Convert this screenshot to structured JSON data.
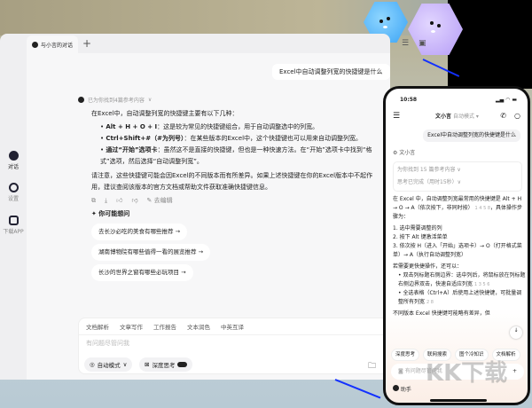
{
  "tab": {
    "title": "与小言的对话",
    "new_tab": "+"
  },
  "sidebar": [
    {
      "label": "对话"
    },
    {
      "label": "设置"
    },
    {
      "label": "下载APP"
    }
  ],
  "desktop": {
    "user_question": "Excel中自动调整列宽的快捷键是什么",
    "refs": "已为你找到4篇参考内容",
    "intro": "在Excel中，自动调整列宽的快捷键主要有以下几种：",
    "bullets": [
      {
        "bold": "Alt + H + O + I",
        "text": "：这是较为常见的快捷键组合，用于自动调整选中的列宽。"
      },
      {
        "bold": "Ctrl+Shift+#（#为列号）",
        "text": "：在某些版本的Excel中，这个快捷键也可以用来自动调整列宽。"
      },
      {
        "bold": "通过“开始”选项卡",
        "text": "：虽然这不是直接的快捷键，但也是一种快速方法。在“开始”选项卡中找到“格式”选项，然后选择“自动调整列宽”。"
      }
    ],
    "note": "请注意，这些快捷键可能会因Excel的不同版本而有所差异。如果上述快捷键在你的Excel版本中不起作用，建议查阅该版本的官方文档或帮助文件获取准确快捷键信息。",
    "edit": "去编辑",
    "suggest_title": "✦ 你可能想问",
    "suggestions": [
      "去长沙必吃的美食有哪些推荐 →",
      "湖南博物院有哪些值得一看的展览推荐 →",
      "长沙的世界之窗有哪些必玩项目 →"
    ],
    "quick_tools": [
      "文档解析",
      "文章写作",
      "工作报告",
      "文本润色",
      "中英互译"
    ],
    "placeholder": "有问题尽管问我",
    "mode": "自动模式",
    "deep": "深度思考"
  },
  "phone": {
    "time": "10:58",
    "title": "文小言",
    "mode": "自动模式 ▾",
    "question": "Excel中自动调整列宽的快捷键是什么",
    "bot": "文小言",
    "refs": "为你找到 15 篇参考内容 ∨",
    "thinking": "思考已完成（用时15秒）∨",
    "intro": "在 Excel 中，自动调整列宽最常用的快捷键是 Alt + H → O → A（依次按下，非同时按）",
    "intro_cites": "1 4 5 8",
    "steps_label": "，具体操作步骤为：",
    "steps": [
      "1. 选中需要调整的列",
      "2. 按下 Alt 键激活菜单",
      "3. 依次按 H（进入「开始」选项卡）→ O（打开格式菜单）→ A（执行自动调整列宽）"
    ],
    "more": "若需要更快捷操作，还可以：",
    "tips": [
      {
        "text": "双击列标题右侧边界：选中列后，将鼠标放在列标题右侧边界双击，快速自适应列宽",
        "cites": "1 3 5 6"
      },
      {
        "text": "全选表格（Ctrl+A）后使用上述快捷键，可批量调整所有列宽",
        "cites": "2 8"
      }
    ],
    "tail": "不同版本 Excel 快捷键可能略有差异，但",
    "chips": [
      "深度思考",
      "联网搜索",
      "图个冷知识",
      "文档解析"
    ],
    "placeholder": "有问题尽管问我",
    "assistant": "助手"
  },
  "watermark": "KK下载"
}
